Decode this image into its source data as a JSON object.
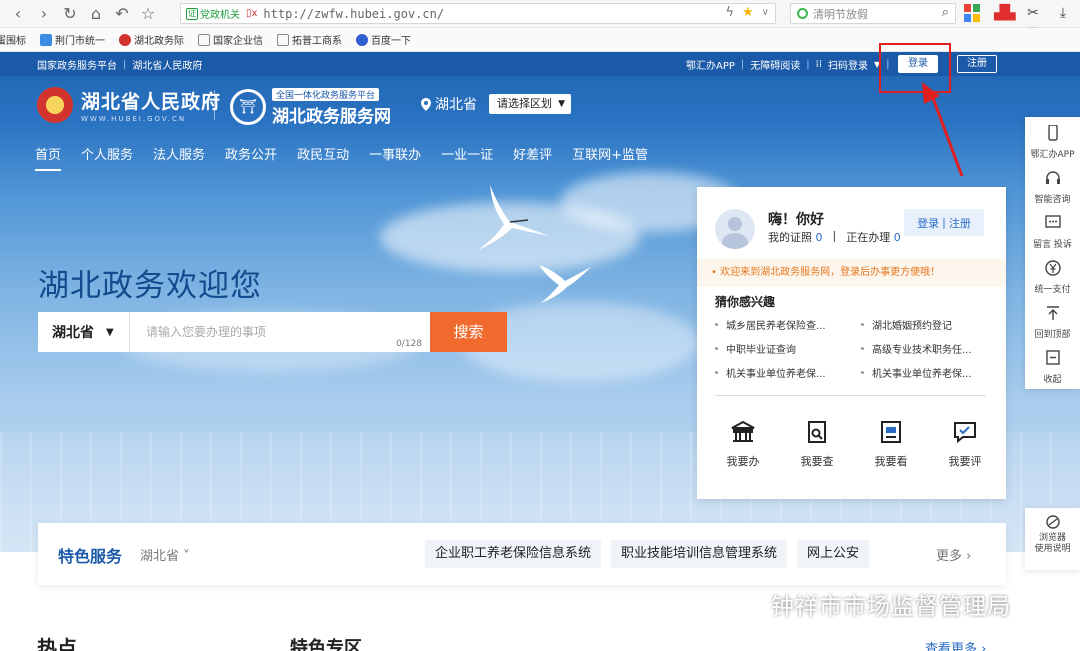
{
  "browser": {
    "gov_badge": "党政机关",
    "url": "http://zwfw.hubei.gov.cn/",
    "search_placeholder": "清明节放假",
    "bookmarks": [
      "蛋围标",
      "荆门市统一",
      "湖北政务际",
      "国家企业信",
      "拓普工商系",
      "百度一下"
    ]
  },
  "topbar": {
    "left": [
      "国家政务服务平台",
      "湖北省人民政府"
    ],
    "right": [
      "鄂汇办APP",
      "无障碍阅读",
      "扫码登录"
    ],
    "login": "登录",
    "register": "注册"
  },
  "header": {
    "gov_name": "湖北省人民政府",
    "gov_en": "WWW.HUBEI.GOV.CN",
    "platform_tag": "全国一体化政务服务平台",
    "platform_name": "湖北政务服务网",
    "location": "湖北省",
    "region_select": "请选择区划"
  },
  "nav": [
    "首页",
    "个人服务",
    "法人服务",
    "政务公开",
    "政民互动",
    "一事联办",
    "一业一证",
    "好差评",
    "互联网+监管"
  ],
  "hero": {
    "title": "湖北政务欢迎您",
    "province": "湖北省",
    "search_placeholder": "请输入您要办理的事项",
    "char_count": "0/128",
    "search_button": "搜索"
  },
  "user_card": {
    "greeting": "嗨！你好",
    "license_label": "我的证照",
    "license_count": "0",
    "pending_label": "正在办理",
    "pending_count": "0",
    "login": "登录",
    "sep": "|",
    "register": "注册",
    "notice": "• 欢迎来到湖北政务服务网，登录后办事更方便哦！",
    "guess_title": "猜你感兴趣",
    "guess_items": [
      "城乡居民养老保险查...",
      "湖北婚姻预约登记",
      "中职毕业证查询",
      "高级专业技术职务任...",
      "机关事业单位养老保...",
      "机关事业单位养老保..."
    ],
    "quick": [
      "我要办",
      "我要查",
      "我要看",
      "我要评"
    ]
  },
  "float_bar": [
    "鄂汇办APP",
    "智能咨询",
    "留言 投诉",
    "统一支付",
    "回到顶部",
    "收起"
  ],
  "float_bar2": [
    "浏览器",
    "使用说明"
  ],
  "feature": {
    "title": "特色服务",
    "province": "湖北省",
    "chips": [
      "企业职工养老保险信息系统",
      "职业技能培训信息管理系统",
      "网上公安"
    ],
    "more": "更多"
  },
  "bottom": {
    "left": "热点",
    "mid": "特色专区",
    "right": "查看更多"
  },
  "watermark": "钟祥市市场监督管理局",
  "colors": {
    "header_blue": "#1b5aa8",
    "search_orange": "#f06a2e",
    "highlight_red": "#e02020",
    "link_blue": "#2a6cc4"
  }
}
